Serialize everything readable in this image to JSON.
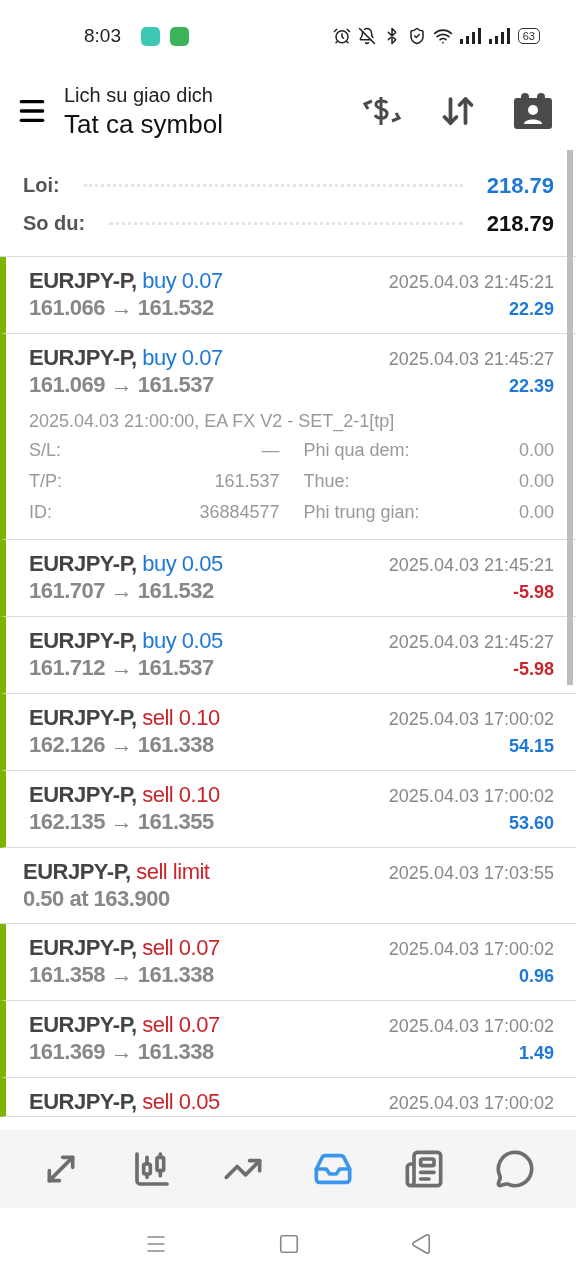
{
  "status_bar": {
    "time": "8:03",
    "battery": "63"
  },
  "header": {
    "subtitle": "Lich su giao dich",
    "title": "Tat ca symbol"
  },
  "summary": [
    {
      "label": "Loi:",
      "value": "218.79",
      "highlight": true
    },
    {
      "label": "So du:",
      "value": "218.79",
      "highlight": false
    }
  ],
  "deals": [
    {
      "kind": "deal",
      "symbol": "EURJPY-P,",
      "type": "buy 0.07",
      "color": "#1e78d8",
      "time": "2025.04.03 21:45:21",
      "prices": "161.066 → 161.532",
      "profit": "22.29",
      "loss": false,
      "expanded": false
    },
    {
      "kind": "deal",
      "symbol": "EURJPY-P,",
      "type": "buy 0.07",
      "color": "#1e78d8",
      "time": "2025.04.03 21:45:27",
      "prices": "161.069 → 161.537",
      "profit": "22.39",
      "loss": false,
      "expanded": true,
      "comment": "2025.04.03 21:00:00, EA FX V2 - SET_2-1[tp]",
      "details": [
        {
          "label": "S/L:",
          "value": "—",
          "label2": "Phi qua dem:",
          "value2": "0.00"
        },
        {
          "label": "T/P:",
          "value": "161.537",
          "label2": "Thue:",
          "value2": "0.00"
        },
        {
          "label": "ID:",
          "value": "36884577",
          "label2": "Phi trung gian:",
          "value2": "0.00"
        }
      ]
    },
    {
      "kind": "deal",
      "symbol": "EURJPY-P,",
      "type": "buy 0.05",
      "color": "#1e78d8",
      "time": "2025.04.03 21:45:21",
      "prices": "161.707 → 161.532",
      "profit": "-5.98",
      "loss": true,
      "expanded": false
    },
    {
      "kind": "deal",
      "symbol": "EURJPY-P,",
      "type": "buy 0.05",
      "color": "#1e78d8",
      "time": "2025.04.03 21:45:27",
      "prices": "161.712 → 161.537",
      "profit": "-5.98",
      "loss": true,
      "expanded": false
    },
    {
      "kind": "deal",
      "symbol": "EURJPY-P,",
      "type": "sell 0.10",
      "color": "#c8252c",
      "time": "2025.04.03 17:00:02",
      "prices": "162.126 → 161.338",
      "profit": "54.15",
      "loss": false,
      "expanded": false
    },
    {
      "kind": "deal",
      "symbol": "EURJPY-P,",
      "type": "sell 0.10",
      "color": "#c8252c",
      "time": "2025.04.03 17:00:02",
      "prices": "162.135 → 161.355",
      "profit": "53.60",
      "loss": false,
      "expanded": false
    },
    {
      "kind": "order",
      "symbol": "EURJPY-P,",
      "type": "sell limit",
      "color": "#c8252c",
      "time": "2025.04.03 17:03:55",
      "prices": "0.50 at 163.900",
      "expanded": false
    },
    {
      "kind": "deal",
      "symbol": "EURJPY-P,",
      "type": "sell 0.07",
      "color": "#c8252c",
      "time": "2025.04.03 17:00:02",
      "prices": "161.358 → 161.338",
      "profit": "0.96",
      "loss": false,
      "expanded": false
    },
    {
      "kind": "deal",
      "symbol": "EURJPY-P,",
      "type": "sell 0.07",
      "color": "#c8252c",
      "time": "2025.04.03 17:00:02",
      "prices": "161.369 → 161.338",
      "profit": "1.49",
      "loss": false,
      "expanded": false
    },
    {
      "kind": "deal",
      "symbol": "EURJPY-P,",
      "type": "sell 0.05",
      "color": "#c8252c",
      "time": "2025.04.03 17:00:02",
      "expanded": false
    }
  ],
  "tabs": [
    {
      "kind": "quotes",
      "selected": false
    },
    {
      "kind": "chart",
      "selected": false
    },
    {
      "kind": "trade",
      "selected": false
    },
    {
      "kind": "history",
      "selected": true
    },
    {
      "kind": "news",
      "selected": false
    },
    {
      "kind": "chat",
      "selected": false
    }
  ]
}
